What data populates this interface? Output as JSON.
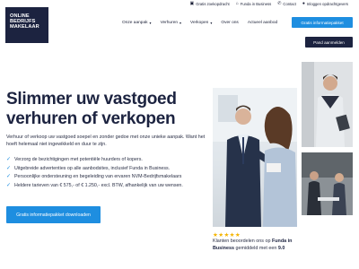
{
  "topbar": {
    "items": [
      {
        "icon": "calendar-icon",
        "label": "Gratis zoekopdracht"
      },
      {
        "icon": "home-icon",
        "label": "Funda in Business"
      },
      {
        "icon": "phone-icon",
        "label": "Contact"
      },
      {
        "icon": "user-icon",
        "label": "Inloggen opdrachtgevers"
      }
    ]
  },
  "logo": {
    "line1": "ONLINE",
    "line2": "BEDRIJFS",
    "line3": "MAKELAAR"
  },
  "nav": {
    "items": [
      "Onze aanpak",
      "Verhuren",
      "Verkopen",
      "Over ons",
      "Actueel aanbod"
    ],
    "cta": "Gratis informatiepakket",
    "login": "Pand aanmelden"
  },
  "hero": {
    "title": "Slimmer uw vastgoed verhuren of verkopen",
    "intro": "Verhuur of verkoop uw vastgoed soepel en zonder gedoe met onze unieke aanpak. Want het hoeft helemaal niet ingewikkeld en duur te zijn.",
    "bullets": [
      "Verzorg de bezichtigingen met potentiële huurders of kopers.",
      "Uitgebreide advertenties op alle aanbodsites, inclusief Funda in Business.",
      "Persoonlijke ondersteuning en begeleiding van ervaren NVM-Bedrijfsmakelaars",
      "Heldere tarieven van € 575,- of € 1.250,- excl. BTW, afhankelijk van uw wensen."
    ],
    "button": "Gratis informatiepakket downloaden"
  },
  "rating": {
    "stars": "★★★★★",
    "text_before": "Klanten beoordelen ons op ",
    "source": "Funda in Business",
    "text_mid": " gemiddeld met een ",
    "score": "9.0"
  },
  "colors": {
    "navy": "#1c2340",
    "blue": "#1e8ee0",
    "star": "#f4b400"
  }
}
